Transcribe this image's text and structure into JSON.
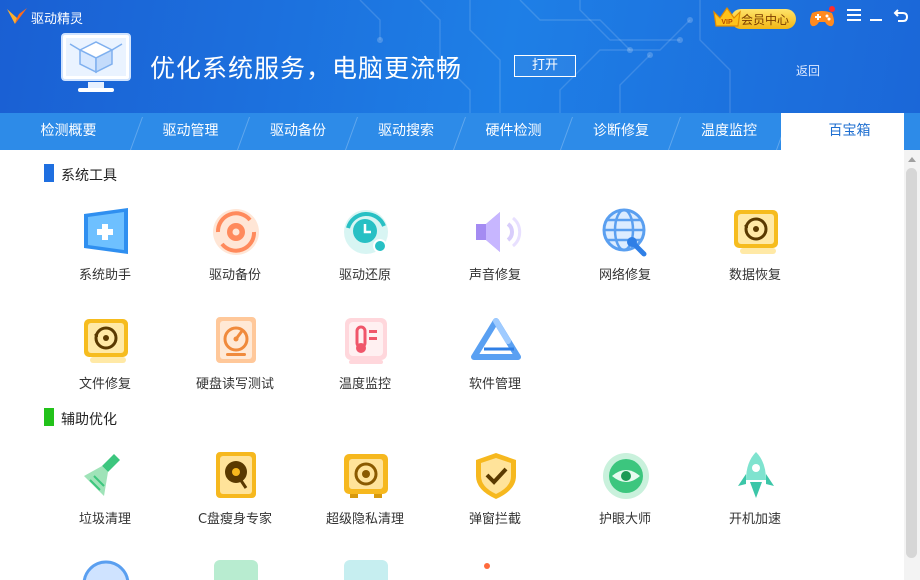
{
  "app": {
    "title": "驱动精灵"
  },
  "banner": {
    "text": "优化系统服务，电脑更流畅",
    "open_label": "打开",
    "back_label": "返回"
  },
  "header": {
    "vip_label": "会员中心",
    "vip_badge_text": "VIP"
  },
  "nav": {
    "tabs": [
      {
        "label": "检测概要"
      },
      {
        "label": "驱动管理"
      },
      {
        "label": "驱动备份"
      },
      {
        "label": "驱动搜索"
      },
      {
        "label": "硬件检测"
      },
      {
        "label": "诊断修复"
      },
      {
        "label": "温度监控"
      },
      {
        "label": "百宝箱",
        "active": true
      }
    ]
  },
  "sections": [
    {
      "title": "系统工具",
      "accent": "#1f6fe0",
      "tools": [
        {
          "label": "系统助手",
          "icon": "system-assistant-icon"
        },
        {
          "label": "驱动备份",
          "icon": "driver-backup-icon"
        },
        {
          "label": "驱动还原",
          "icon": "driver-restore-icon"
        },
        {
          "label": "声音修复",
          "icon": "sound-repair-icon"
        },
        {
          "label": "网络修复",
          "icon": "network-repair-icon"
        },
        {
          "label": "数据恢复",
          "icon": "data-recovery-icon"
        },
        {
          "label": "文件修复",
          "icon": "file-repair-icon"
        },
        {
          "label": "硬盘读写测试",
          "icon": "disk-speed-test-icon"
        },
        {
          "label": "温度监控",
          "icon": "thermometer-icon"
        },
        {
          "label": "软件管理",
          "icon": "software-manager-icon"
        }
      ]
    },
    {
      "title": "辅助优化",
      "accent": "#22c21a",
      "tools": [
        {
          "label": "垃圾清理",
          "icon": "broom-icon"
        },
        {
          "label": "C盘瘦身专家",
          "icon": "c-drive-slim-icon"
        },
        {
          "label": "超级隐私清理",
          "icon": "safe-icon"
        },
        {
          "label": "弹窗拦截",
          "icon": "shield-check-icon"
        },
        {
          "label": "护眼大师",
          "icon": "eye-icon"
        },
        {
          "label": "开机加速",
          "icon": "rocket-icon"
        }
      ]
    }
  ],
  "colors": {
    "header_blue": "#1e7fe6",
    "nav_blue": "#2d8be8",
    "active_tab_text": "#1f6fd0"
  }
}
